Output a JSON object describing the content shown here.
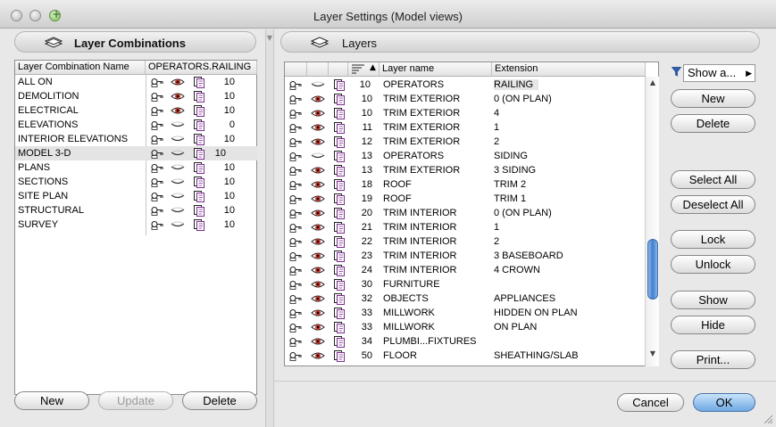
{
  "window": {
    "title": "Layer Settings (Model views)"
  },
  "left_panel": {
    "header": "Layer Combinations",
    "columns": {
      "name": "Layer Combination Name",
      "operators": "OPERATORS.RAILING"
    },
    "rows": [
      {
        "name": "ALL ON",
        "eye": "open",
        "value": "10"
      },
      {
        "name": "DEMOLITION",
        "eye": "open",
        "value": "10"
      },
      {
        "name": "ELECTRICAL",
        "eye": "open",
        "value": "10"
      },
      {
        "name": "ELEVATIONS",
        "eye": "hidden",
        "value": "0"
      },
      {
        "name": "INTERIOR ELEVATIONS",
        "eye": "hidden",
        "value": "10"
      },
      {
        "name": "MODEL 3-D",
        "eye": "hidden",
        "value": "10",
        "selected": true
      },
      {
        "name": "PLANS",
        "eye": "hidden",
        "value": "10"
      },
      {
        "name": "SECTIONS",
        "eye": "hidden",
        "value": "10"
      },
      {
        "name": "SITE PLAN",
        "eye": "hidden",
        "value": "10"
      },
      {
        "name": "STRUCTURAL",
        "eye": "hidden",
        "value": "10"
      },
      {
        "name": "SURVEY",
        "eye": "hidden",
        "value": "10"
      }
    ],
    "buttons": {
      "new": "New",
      "update": "Update",
      "delete": "Delete"
    }
  },
  "right_panel": {
    "header": "Layers",
    "columns": {
      "name": "Layer name",
      "extension": "Extension"
    },
    "rows": [
      {
        "num": "10",
        "name": "OPERATORS",
        "ext": "RAILING",
        "eye": "hidden"
      },
      {
        "num": "10",
        "name": "TRIM EXTERIOR",
        "ext": "0 (ON PLAN)",
        "eye": "open"
      },
      {
        "num": "10",
        "name": "TRIM EXTERIOR",
        "ext": "4",
        "eye": "open"
      },
      {
        "num": "11",
        "name": "TRIM EXTERIOR",
        "ext": "1",
        "eye": "open"
      },
      {
        "num": "12",
        "name": "TRIM EXTERIOR",
        "ext": "2",
        "eye": "open"
      },
      {
        "num": "13",
        "name": "OPERATORS",
        "ext": "SIDING",
        "eye": "hidden"
      },
      {
        "num": "13",
        "name": "TRIM EXTERIOR",
        "ext": "3 SIDING",
        "eye": "open"
      },
      {
        "num": "18",
        "name": "ROOF",
        "ext": "TRIM 2",
        "eye": "open"
      },
      {
        "num": "19",
        "name": "ROOF",
        "ext": "TRIM 1",
        "eye": "open"
      },
      {
        "num": "20",
        "name": "TRIM INTERIOR",
        "ext": "0 (ON PLAN)",
        "eye": "open"
      },
      {
        "num": "21",
        "name": "TRIM INTERIOR",
        "ext": "1",
        "eye": "open"
      },
      {
        "num": "22",
        "name": "TRIM INTERIOR",
        "ext": "2",
        "eye": "open"
      },
      {
        "num": "23",
        "name": "TRIM INTERIOR",
        "ext": "3 BASEBOARD",
        "eye": "open"
      },
      {
        "num": "24",
        "name": "TRIM INTERIOR",
        "ext": "4 CROWN",
        "eye": "open"
      },
      {
        "num": "30",
        "name": "FURNITURE",
        "ext": "",
        "eye": "open"
      },
      {
        "num": "32",
        "name": "OBJECTS",
        "ext": "APPLIANCES",
        "eye": "open"
      },
      {
        "num": "33",
        "name": "MILLWORK",
        "ext": "HIDDEN ON PLAN",
        "eye": "open"
      },
      {
        "num": "33",
        "name": "MILLWORK",
        "ext": "ON PLAN",
        "eye": "open"
      },
      {
        "num": "34",
        "name": "PLUMBI...FIXTURES",
        "ext": "",
        "eye": "open"
      },
      {
        "num": "50",
        "name": "FLOOR",
        "ext": "SHEATHING/SLAB",
        "eye": "open"
      }
    ],
    "buttons": {
      "show_all": "Show a...",
      "new": "New",
      "delete": "Delete",
      "select_all": "Select All",
      "deselect_all": "Deselect All",
      "lock": "Lock",
      "unlock": "Unlock",
      "show": "Show",
      "hide": "Hide",
      "print": "Print..."
    }
  },
  "footer": {
    "cancel": "Cancel",
    "ok": "OK"
  },
  "colors": {
    "eye_open": "#c0392b",
    "doc_icon": "#7a2d8c",
    "accent": "#3f7fd0"
  }
}
